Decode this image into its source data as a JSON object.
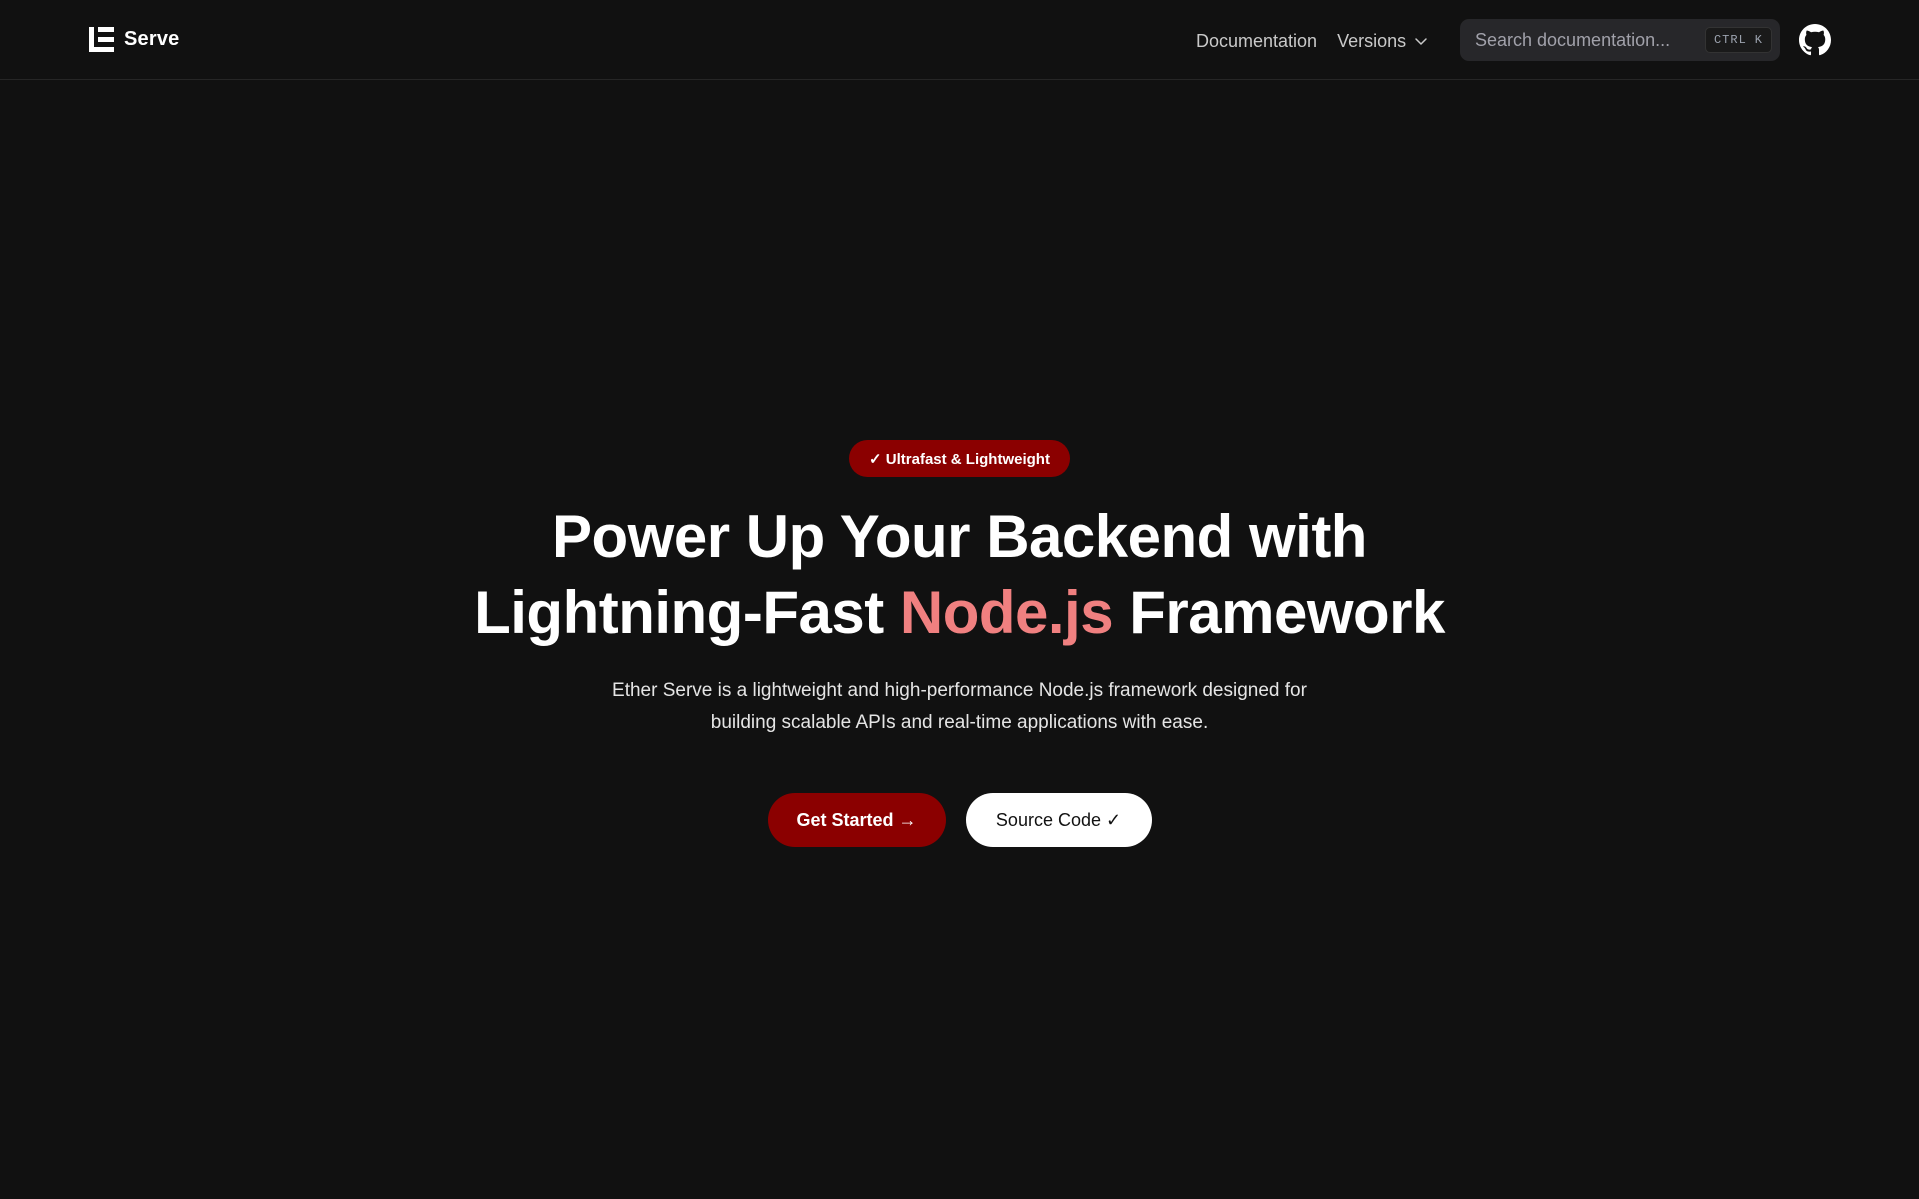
{
  "brand": {
    "name": "Serve"
  },
  "nav": {
    "documentation": "Documentation",
    "versions": "Versions"
  },
  "search": {
    "placeholder": "Search documentation...",
    "shortcut_ctrl": "CTRL",
    "shortcut_key": "K"
  },
  "hero": {
    "badge": "✓ Ultrafast & Lightweight",
    "headline_line1": "Power Up Your Backend with",
    "headline_line2_pre": "Lightning-Fast ",
    "headline_line2_accent": "Node.js",
    "headline_line2_post": " Framework",
    "subtitle": "Ether Serve is a lightweight and high-performance Node.js framework designed for building scalable APIs and real-time applications with ease.",
    "primary_button": "Get Started →",
    "secondary_button": "Source Code ✓"
  },
  "colors": {
    "background": "#111111",
    "accent_red": "#8b0000",
    "accent_pink": "#f08080",
    "nav_text": "#c9c9c9",
    "search_bg": "#27272a"
  },
  "icons": {
    "logo": "ether-logo-icon",
    "versions_chevron": "chevron-down-icon",
    "github": "github-icon"
  }
}
